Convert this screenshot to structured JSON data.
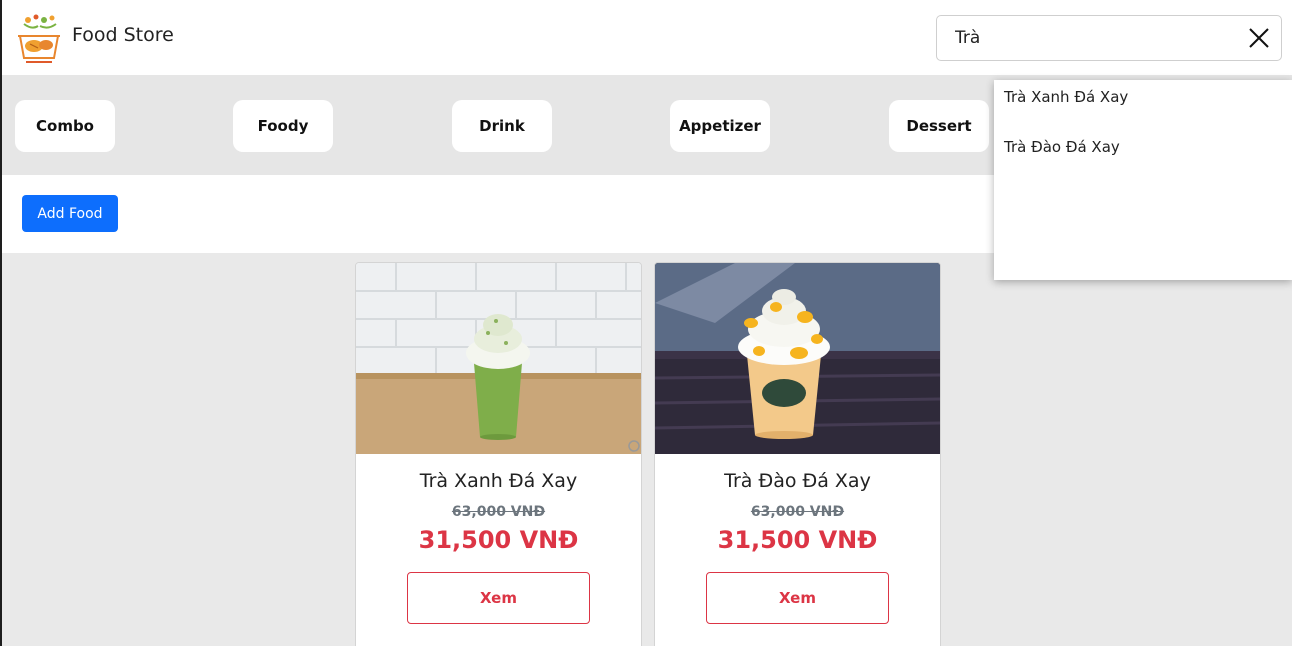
{
  "header": {
    "brand": "Food Store",
    "search": {
      "value": "Trà",
      "placeholder": ""
    }
  },
  "categories": [
    "Combo",
    "Foody",
    "Drink",
    "Appetizer",
    "Dessert"
  ],
  "actions": {
    "add_food_label": "Add Food"
  },
  "search_suggestions": [
    "Trà Xanh Đá Xay",
    "Trà Đào Đá Xay"
  ],
  "products": [
    {
      "name": "Trà Xanh Đá Xay",
      "old_price": "63,000 VNĐ",
      "price": "31,500 VNĐ",
      "button": "Xem",
      "image": "green-tea-frappe-image"
    },
    {
      "name": "Trà Đào Đá Xay",
      "old_price": "63,000 VNĐ",
      "price": "31,500 VNĐ",
      "button": "Xem",
      "image": "peach-tea-frappe-image"
    }
  ],
  "colors": {
    "primary": "#0d6efd",
    "danger": "#dc3545",
    "muted": "#6c757d"
  }
}
